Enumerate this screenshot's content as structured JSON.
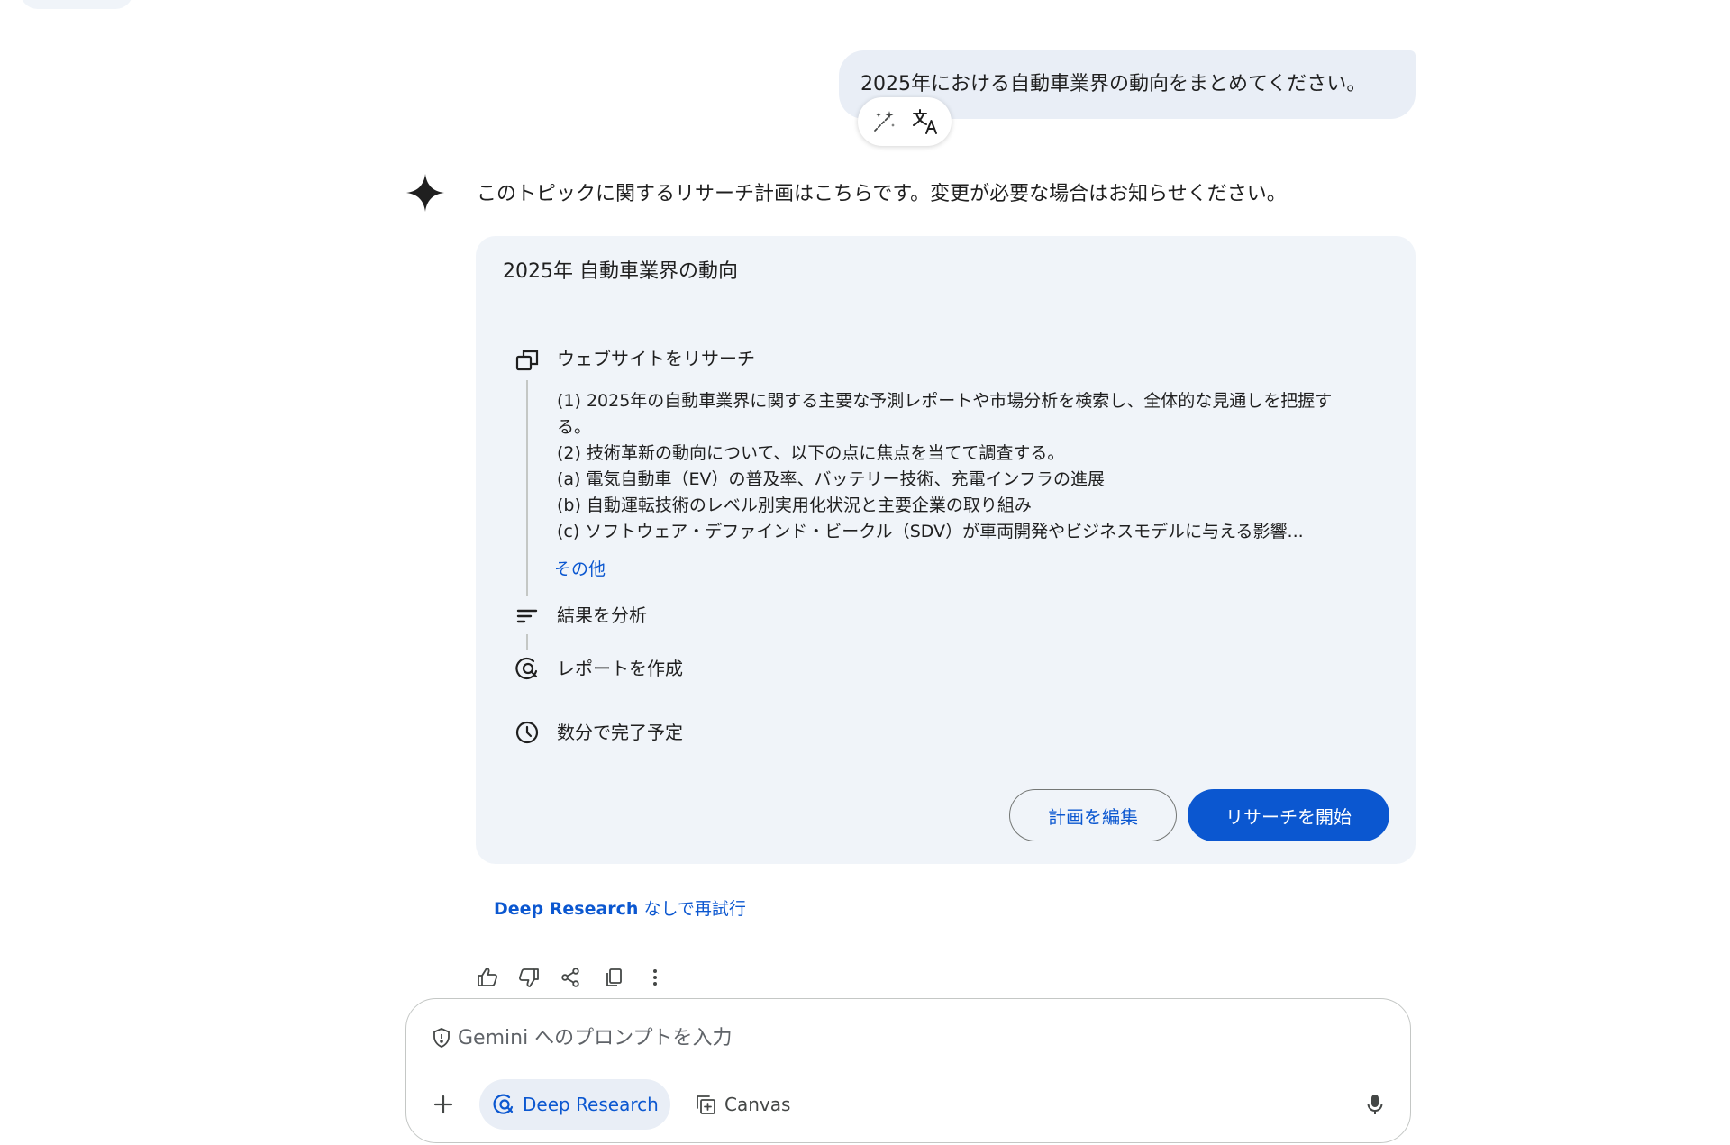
{
  "user_message": {
    "text": "2025年における自動車業界の動向をまとめてください。"
  },
  "bubble_tools": {
    "icons": [
      "magic-wand-icon",
      "translate-icon"
    ]
  },
  "response": {
    "intro": "このトピックに関するリサーチ計画はこちらです。変更が必要な場合はお知らせください。",
    "plan": {
      "title": "2025年 自動車業界の動向",
      "steps": [
        {
          "label": "ウェブサイトをリサーチ",
          "icon": "web-research-icon",
          "details": [
            "(1) 2025年の自動車業界に関する主要な予測レポートや市場分析を検索し、全体的な見通しを把握す",
            "る。",
            "(2) 技術革新の動向について、以下の点に焦点を当てて調査する。",
            "(a) 電気自動車（EV）の普及率、バッテリー技術、充電インフラの進展",
            "(b) 自動運転技術のレベル別実用化状況と主要企業の取り組み",
            "(c) ソフトウェア・デファインド・ビークル（SDV）が車両開発やビジネスモデルに与える影響..."
          ],
          "more_link": "その他"
        },
        {
          "label": "結果を分析",
          "icon": "analyze-icon"
        },
        {
          "label": "レポートを作成",
          "icon": "report-icon"
        },
        {
          "label": "数分で完了予定",
          "icon": "clock-icon"
        }
      ],
      "edit_button": "計画を編集",
      "start_button": "リサーチを開始"
    },
    "retry": {
      "strong": "Deep Research",
      "rest": " なしで再試行"
    }
  },
  "feedback": {
    "icons": [
      "thumbs-up-icon",
      "thumbs-down-icon",
      "share-icon",
      "copy-icon",
      "more-vert-icon"
    ]
  },
  "prompt": {
    "placeholder": "Gemini へのプロンプトを入力",
    "value": "",
    "deep_research_label": "Deep Research",
    "canvas_label": "Canvas"
  },
  "colors": {
    "accent": "#0b57d0",
    "card_bg": "#f0f4f9",
    "bubble_bg": "#e9eef6"
  }
}
